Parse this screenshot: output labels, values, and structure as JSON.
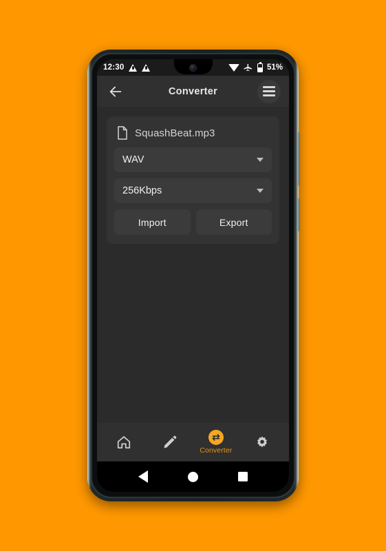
{
  "theme": {
    "page_background": "#FF9800",
    "screen_background": "#2b2b2b",
    "surface": "#333333",
    "control_surface": "#3b3b3b",
    "accent": "#f5a623",
    "accent_text": "#e89412",
    "text_primary": "#f0f0f0",
    "text_secondary": "#d3d3d3"
  },
  "status_bar": {
    "clock": "12:30",
    "warning_icon_1": "warning-triangle-icon",
    "warning_icon_2": "warning-triangle-icon",
    "wifi_icon": "wifi-icon",
    "airplane_icon": "airplane-mode-icon",
    "battery_icon": "battery-icon",
    "battery_percent": "51%"
  },
  "app_bar": {
    "back_icon": "back-arrow-icon",
    "title": "Converter",
    "menu_icon": "hamburger-menu-icon"
  },
  "card": {
    "file": {
      "icon": "file-document-icon",
      "name": "SquashBeat.mp3"
    },
    "format_dropdown": {
      "value": "WAV",
      "caret_icon": "chevron-down-icon"
    },
    "bitrate_dropdown": {
      "value": "256Kbps",
      "caret_icon": "chevron-down-icon"
    },
    "import_label": "Import",
    "export_label": "Export"
  },
  "bottom_nav": {
    "items": [
      {
        "name": "home",
        "icon": "home-icon",
        "label": "",
        "active": false
      },
      {
        "name": "edit",
        "icon": "pencil-icon",
        "label": "",
        "active": false
      },
      {
        "name": "converter",
        "icon": "convert-arrows-icon",
        "label": "Converter",
        "active": true
      },
      {
        "name": "settings",
        "icon": "gear-icon",
        "label": "",
        "active": false
      }
    ]
  },
  "system_nav": {
    "back_icon": "triangle-back-icon",
    "home_icon": "circle-home-icon",
    "recents_icon": "square-recents-icon"
  }
}
